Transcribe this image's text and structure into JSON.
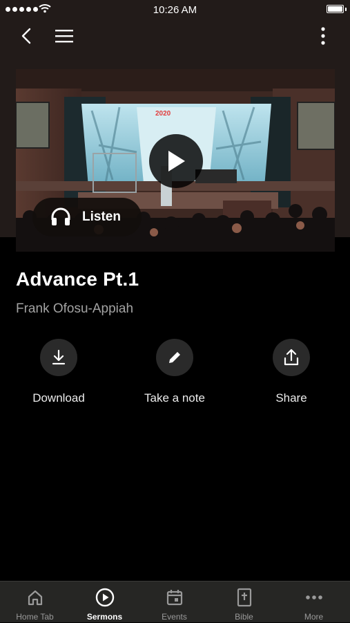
{
  "status_bar": {
    "time": "10:26 AM"
  },
  "sermon": {
    "title": "Advance Pt.1",
    "speaker": "Frank Ofosu-Appiah",
    "listen_label": "Listen",
    "stage_sign": "2020"
  },
  "actions": [
    {
      "label": "Download",
      "icon": "download-icon"
    },
    {
      "label": "Take a note",
      "icon": "pencil-icon"
    },
    {
      "label": "Share",
      "icon": "share-icon"
    }
  ],
  "tabs": [
    {
      "label": "Home Tab",
      "icon": "home-icon",
      "active": false
    },
    {
      "label": "Sermons",
      "icon": "play-circle-icon",
      "active": true
    },
    {
      "label": "Events",
      "icon": "calendar-icon",
      "active": false
    },
    {
      "label": "Bible",
      "icon": "bible-icon",
      "active": false
    },
    {
      "label": "More",
      "icon": "more-dots-icon",
      "active": false
    }
  ],
  "colors": {
    "header_bg": "#221b19",
    "background": "#000000",
    "tab_bar_bg": "#262624",
    "action_circle": "#2a2a2a",
    "muted_text": "#a3a3a3"
  }
}
